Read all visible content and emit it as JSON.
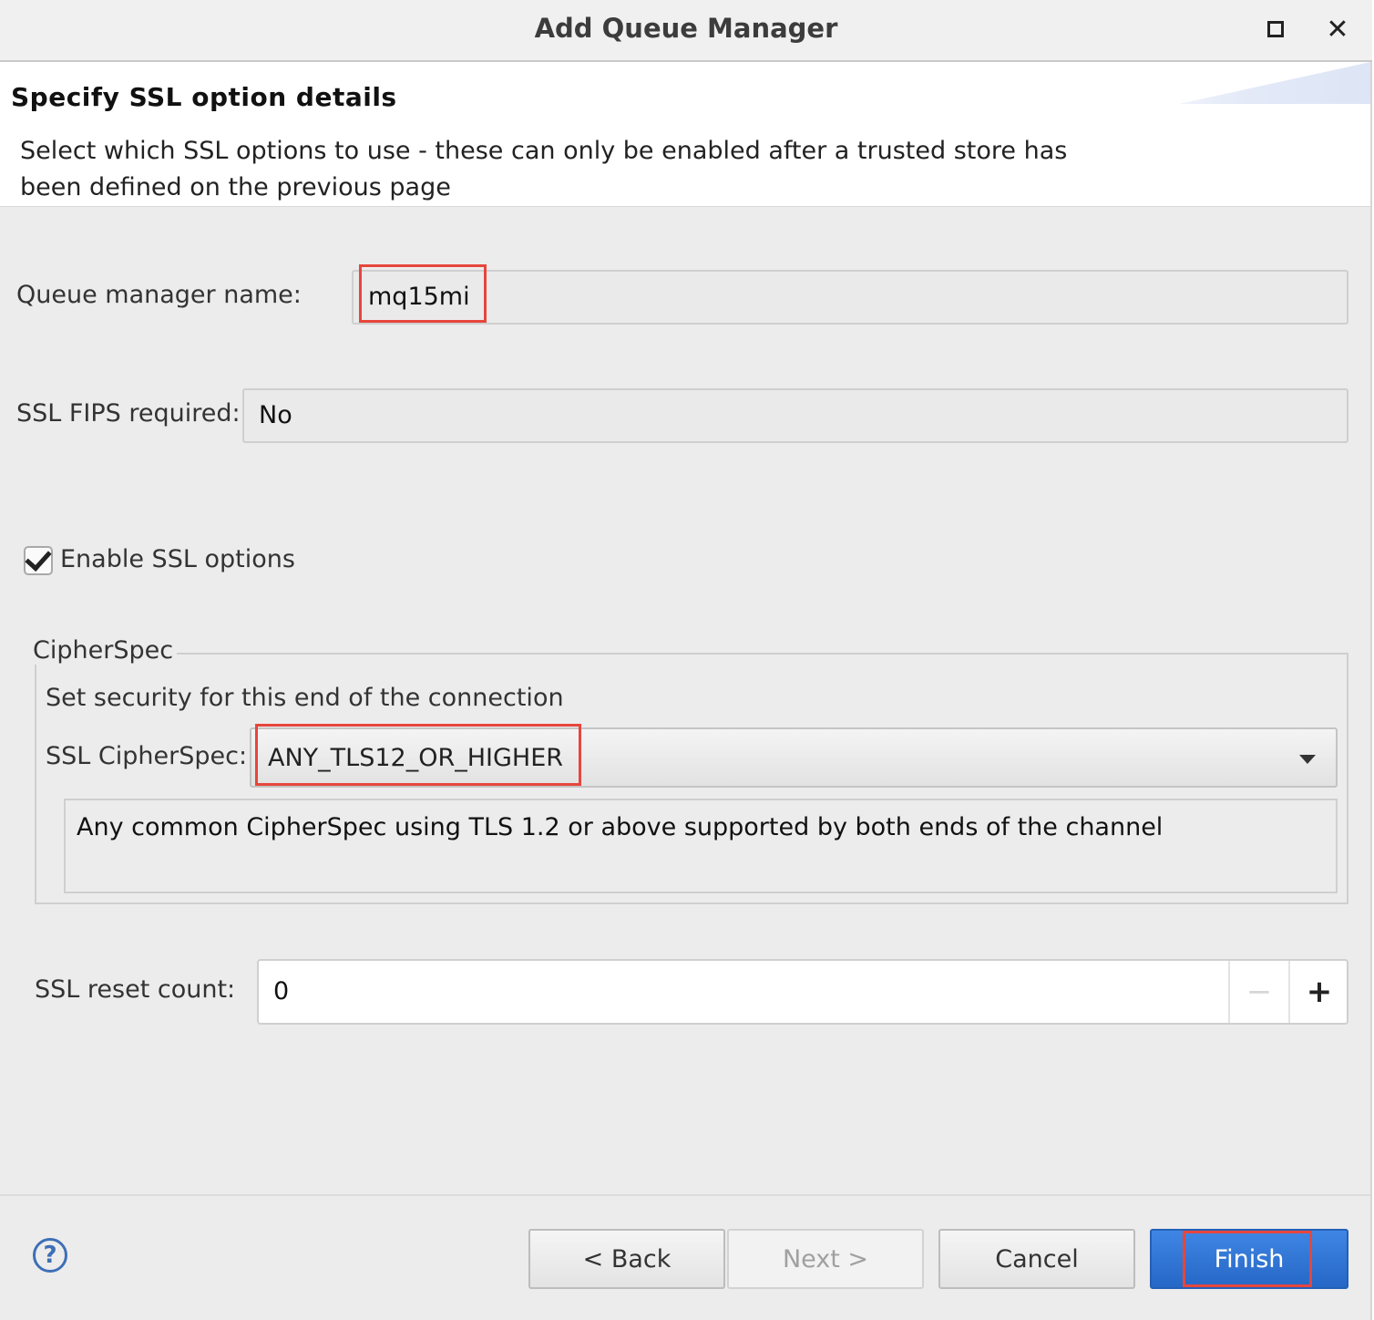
{
  "window": {
    "title": "Add Queue Manager",
    "maximize_glyph": "",
    "close_glyph": "✕"
  },
  "banner": {
    "heading": "Specify SSL option details",
    "description": "Select which SSL options to use - these can only be enabled after a trusted store has been defined on the previous page"
  },
  "form": {
    "qm_name_label": "Queue manager name:",
    "qm_name_value": "mq15mi",
    "fips_label": "SSL FIPS required:",
    "fips_value": "No",
    "enable_ssl_label": "Enable SSL options",
    "enable_ssl_checked": true,
    "cipherspec_group_title": "CipherSpec",
    "cipherspec_group_desc": "Set security for this end of the connection",
    "cipherspec_label": "SSL CipherSpec:",
    "cipherspec_value": "ANY_TLS12_OR_HIGHER",
    "cipherspec_description": "Any common CipherSpec using TLS 1.2 or above supported by both ends of the channel",
    "reset_count_label": "SSL reset count:",
    "reset_count_value": "0",
    "minus_glyph": "−",
    "plus_glyph": "+"
  },
  "footer": {
    "help_glyph": "?",
    "back_label": "< Back",
    "next_label": "Next >",
    "cancel_label": "Cancel",
    "finish_label": "Finish"
  },
  "colors": {
    "highlight": "#e6463c",
    "finish_button": "#2f74d6",
    "help_icon": "#3d6fb6"
  }
}
